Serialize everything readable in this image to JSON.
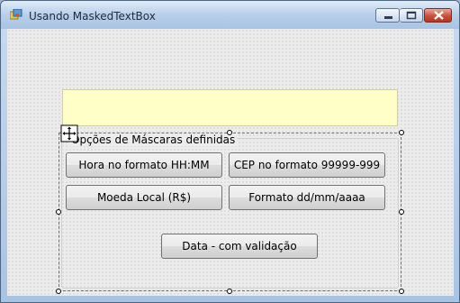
{
  "window": {
    "title": "Usando MaskedTextBox"
  },
  "icons": {
    "app": "forms-app-icon",
    "minimize": "minimize-icon",
    "maximize": "maximize-icon",
    "close": "close-icon",
    "move": "move-icon"
  },
  "group": {
    "label": "Opções de Máscaras definidas"
  },
  "buttons": {
    "hora": "Hora no formato HH:MM",
    "cep": "CEP no formato 99999-999",
    "moeda": "Moeda Local (R$)",
    "formato": "Formato dd/mm/aaaa",
    "data": "Data - com validação"
  },
  "colors": {
    "masked_bg": "#ffffc8",
    "title_bg": "#b8cfe9",
    "close_red": "#c8503b"
  }
}
